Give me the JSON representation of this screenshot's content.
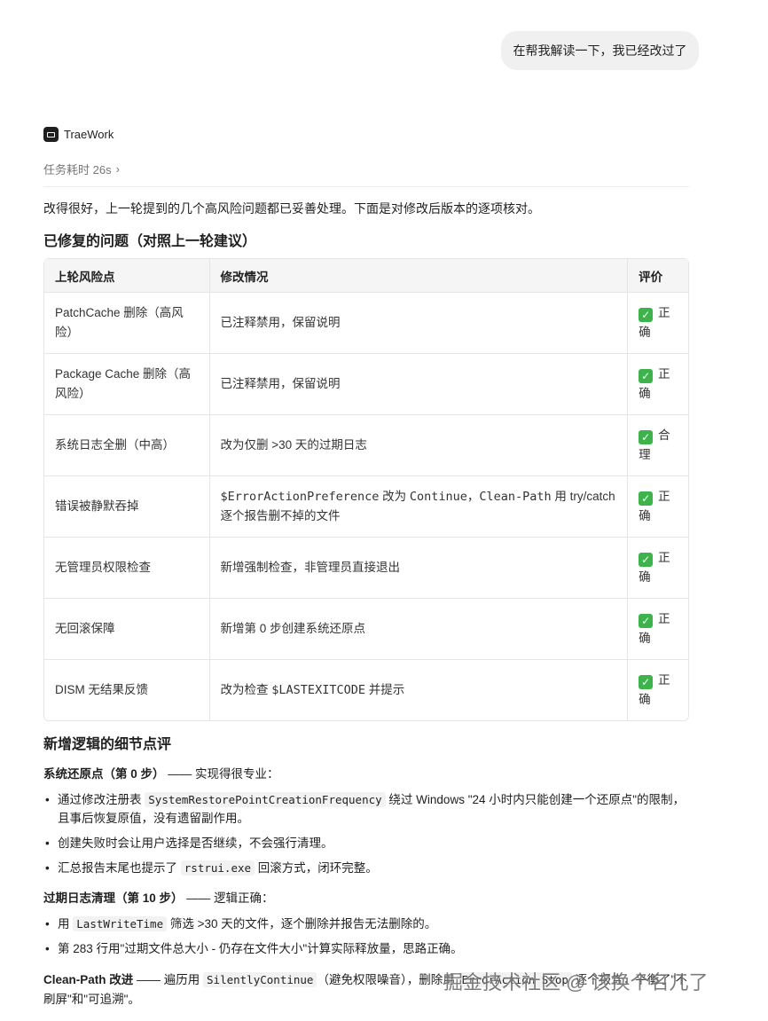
{
  "user_message": "在帮我解读一下，我已经改过了",
  "agent": {
    "name": "TraeWork",
    "task_time": "任务耗时 26s"
  },
  "intro": "改得很好，上一轮提到的几个高风险问题都已妥善处理。下面是对修改后版本的逐项核对。",
  "fixed_heading": "已修复的问题（对照上一轮建议）",
  "table": {
    "headers": [
      "上轮风险点",
      "修改情况",
      "评价"
    ],
    "rows": [
      {
        "risk": "PatchCache 删除（高风险）",
        "change": "已注释禁用，保留说明",
        "verdict": "正确"
      },
      {
        "risk": "Package Cache 删除（高风险）",
        "change": "已注释禁用，保留说明",
        "verdict": "正确"
      },
      {
        "risk": "系统日志全删（中高）",
        "change": "改为仅删 >30 天的过期日志",
        "verdict": "合理"
      },
      {
        "risk": "错误被静默吞掉",
        "change_code": "$ErrorActionPreference",
        "change_mid": " 改为 ",
        "change_code2": "Continue",
        "change_sep": "，",
        "change_code3": "Clean-Path",
        "change_tail": " 用 try/catch 逐个报告删不掉的文件",
        "verdict": "正确"
      },
      {
        "risk": "无管理员权限检查",
        "change": "新增强制检查，非管理员直接退出",
        "verdict": "正确"
      },
      {
        "risk": "无回滚保障",
        "change": "新增第 0 步创建系统还原点",
        "verdict": "正确"
      },
      {
        "risk": "DISM 无结果反馈",
        "change_pre": "改为检查 ",
        "change_code": "$LASTEXITCODE",
        "change_tail": " 并提示",
        "verdict": "正确"
      }
    ]
  },
  "new_heading": "新增逻辑的细节点评",
  "section1": {
    "title_bold": "系统还原点（第 0 步）",
    "title_rest": " —— 实现得很专业：",
    "bullets": [
      {
        "pre": "通过修改注册表 ",
        "code": "SystemRestorePointCreationFrequency",
        "post": " 绕过 Windows \"24 小时内只能创建一个还原点\"的限制，且事后恢复原值，没有遗留副作用。"
      },
      {
        "pre": "创建失败时会让用户选择是否继续，不会强行清理。",
        "code": "",
        "post": ""
      },
      {
        "pre": "汇总报告末尾也提示了 ",
        "code": "rstrui.exe",
        "post": " 回滚方式，闭环完整。"
      }
    ]
  },
  "section2": {
    "title_bold": "过期日志清理（第 10 步）",
    "title_rest": " —— 逻辑正确：",
    "bullets": [
      {
        "pre": "用 ",
        "code": "LastWriteTime",
        "post": " 筛选 >30 天的文件，逐个删除并报告无法删除的。"
      },
      {
        "pre": "第 283 行用\"过期文件总大小 - 仍存在文件大小\"计算实际释放量，思路正确。",
        "code": "",
        "post": ""
      }
    ]
  },
  "clean_path": {
    "title_bold": "Clean-Path 改进",
    "pre": " —— 遍历用 ",
    "code": "SilentlyContinue",
    "mid": "（避免权限噪音），删除用 ",
    "code2": "ErrorAction Stop",
    "post": " 逐个报告，平衡了\"不刷屏\"和\"可追溯\"。"
  },
  "watermark": "掘金技术社区 @ 该换个名儿了"
}
